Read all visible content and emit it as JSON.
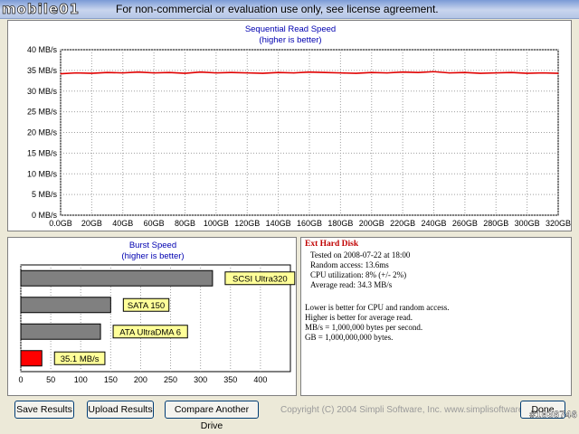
{
  "window": {
    "logo_text": "mobile01",
    "title": "For non-commercial or evaluation use only, see license agreement."
  },
  "read_chart": {
    "title": "Sequential Read Speed",
    "subtitle": "(higher is better)"
  },
  "burst_chart": {
    "title": "Burst Speed",
    "subtitle": "(higher is better)"
  },
  "chart_data": [
    {
      "type": "line",
      "title": "Sequential Read Speed",
      "subtitle": "(higher is better)",
      "xlabel": "",
      "ylabel": "",
      "x_ticks": [
        "0.0GB",
        "20GB",
        "40GB",
        "60GB",
        "80GB",
        "100GB",
        "120GB",
        "140GB",
        "160GB",
        "180GB",
        "200GB",
        "220GB",
        "240GB",
        "260GB",
        "280GB",
        "300GB",
        "320GB"
      ],
      "y_ticks": [
        "0 MB/s",
        "5 MB/s",
        "10 MB/s",
        "15 MB/s",
        "20 MB/s",
        "25 MB/s",
        "30 MB/s",
        "35 MB/s",
        "40 MB/s"
      ],
      "xlim": [
        0,
        320
      ],
      "ylim": [
        0,
        40
      ],
      "grid": true,
      "series": [
        {
          "color": "#e00000",
          "x": [
            0,
            10,
            20,
            30,
            40,
            50,
            60,
            70,
            80,
            90,
            100,
            110,
            120,
            130,
            140,
            150,
            160,
            170,
            180,
            190,
            200,
            210,
            220,
            230,
            240,
            250,
            260,
            270,
            280,
            290,
            300,
            310,
            320
          ],
          "values": [
            34.2,
            34.4,
            34.3,
            34.5,
            34.4,
            34.6,
            34.4,
            34.5,
            34.3,
            34.6,
            34.4,
            34.5,
            34.4,
            34.3,
            34.5,
            34.4,
            34.6,
            34.5,
            34.4,
            34.3,
            34.5,
            34.4,
            34.6,
            34.5,
            34.7,
            34.4,
            34.5,
            34.3,
            34.4,
            34.5,
            34.3,
            34.4,
            34.3
          ]
        }
      ]
    },
    {
      "type": "bar",
      "orientation": "horizontal",
      "title": "Burst Speed",
      "subtitle": "(higher is better)",
      "x_ticks": [
        "0",
        "50",
        "100",
        "150",
        "200",
        "250",
        "300",
        "350",
        "400"
      ],
      "xlim": [
        0,
        450
      ],
      "grid": true,
      "bars": [
        {
          "label": "SCSI Ultra320",
          "value": 320,
          "color": "#808080"
        },
        {
          "label": "SATA 150",
          "value": 150,
          "color": "#808080"
        },
        {
          "label": "ATA UltraDMA 6",
          "value": 133,
          "color": "#808080"
        },
        {
          "label": "35.1 MB/s",
          "value": 35.1,
          "color": "#ff0000"
        }
      ]
    }
  ],
  "info": {
    "disk_name": "Ext Hard Disk",
    "tested_on": "Tested on 2008-07-22 at 18:00",
    "random_access": "Random access: 13.6ms",
    "cpu_utilization": "CPU utilization: 8% (+/- 2%)",
    "average_read": "Average read: 34.3 MB/s",
    "note_lower": "Lower is better for CPU and random access.",
    "note_higher": "Higher is better for average read.",
    "note_mbs": "MB/s = 1,000,000 bytes per second.",
    "note_gb": "GB = 1,000,000,000 bytes."
  },
  "buttons": {
    "save": "Save Results",
    "upload": "Upload Results",
    "compare": "Compare Another Drive",
    "done": "Done"
  },
  "footer": {
    "copyright": "Copyright (C) 2004 Simpli Software, Inc. www.simplisoftware.com",
    "watermark": "#1036746"
  }
}
